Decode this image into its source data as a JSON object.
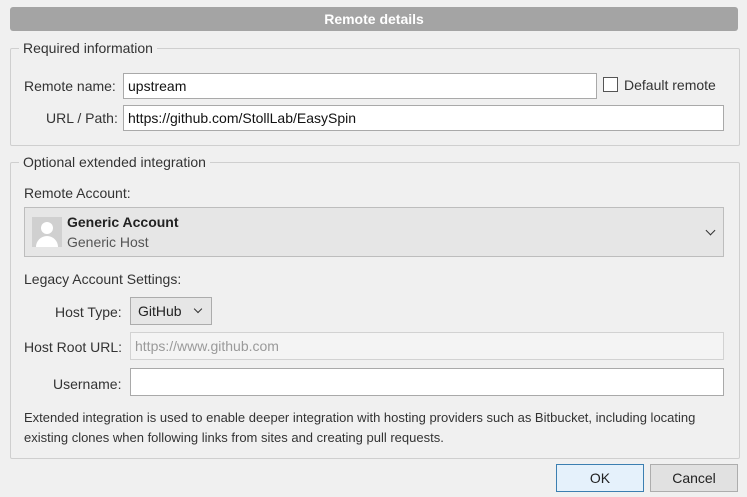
{
  "dialog": {
    "title": "Remote details"
  },
  "required": {
    "legend": "Required information",
    "remote_name_label": "Remote name:",
    "remote_name_value": "upstream",
    "default_remote_label": "Default remote",
    "default_remote_checked": false,
    "url_label": "URL / Path:",
    "url_value": "https://github.com/StollLab/EasySpin"
  },
  "optional": {
    "legend": "Optional extended integration",
    "remote_account_label": "Remote Account:",
    "account": {
      "name": "Generic Account",
      "host": "Generic Host",
      "icon": "avatar-icon"
    },
    "legacy_label": "Legacy Account Settings:",
    "host_type_label": "Host Type:",
    "host_type_value": "GitHub",
    "host_root_label": "Host Root URL:",
    "host_root_placeholder": "https://www.github.com",
    "username_label": "Username:",
    "username_value": "",
    "info": "Extended integration is used to enable deeper integration with hosting providers such as Bitbucket, including locating existing clones when following links from sites and creating pull requests."
  },
  "buttons": {
    "ok": "OK",
    "cancel": "Cancel"
  }
}
